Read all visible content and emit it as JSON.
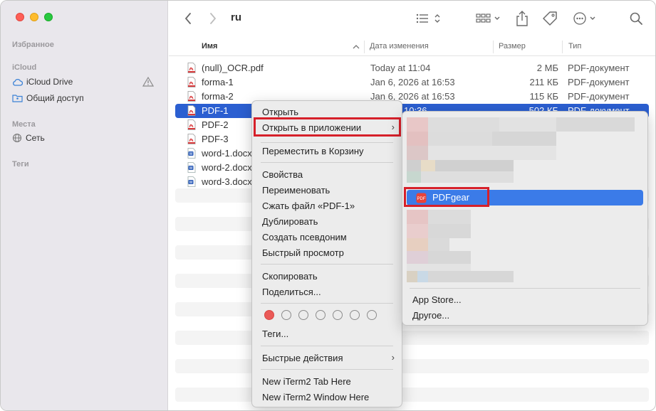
{
  "sidebar": {
    "favorites_heading": "Избранное",
    "icloud_heading": "iCloud",
    "icloud_items": [
      {
        "label": "iCloud Drive",
        "icon": "cloud-icon"
      },
      {
        "label": "Общий доступ",
        "icon": "shared-folder-icon"
      }
    ],
    "locations_heading": "Места",
    "locations_items": [
      {
        "label": "Сеть",
        "icon": "network-globe-icon"
      }
    ],
    "tags_heading": "Теги"
  },
  "toolbar": {
    "folder_title": "ru",
    "icons": [
      "back-chevron-icon",
      "forward-chevron-icon",
      "list-view-icon",
      "grid-view-icon",
      "share-icon",
      "tag-icon",
      "more-actions-icon",
      "search-icon"
    ]
  },
  "columns": {
    "name": "Имя",
    "date": "Дата изменения",
    "size": "Размер",
    "kind": "Тип"
  },
  "files": [
    {
      "name": "(null)_OCR.pdf",
      "date": "Today at 11:04",
      "size": "2 МБ",
      "kind": "PDF-документ",
      "type": "pdf"
    },
    {
      "name": "forma-1",
      "date": "Jan 6, 2026 at 16:53",
      "size": "211 КБ",
      "kind": "PDF-документ",
      "type": "pdf"
    },
    {
      "name": "forma-2",
      "date": "Jan 6, 2026 at 16:53",
      "size": "115 КБ",
      "kind": "PDF-документ",
      "type": "pdf"
    },
    {
      "name": "PDF-1",
      "date": "2026 at 10:36",
      "size": "502 КБ",
      "kind": "PDF-документ",
      "type": "pdf",
      "selected": true
    },
    {
      "name": "PDF-2",
      "date": "",
      "size": "",
      "kind": "",
      "type": "pdf"
    },
    {
      "name": "PDF-3",
      "date": "",
      "size": "",
      "kind": "",
      "type": "pdf"
    },
    {
      "name": "word-1.docx",
      "date": "",
      "size": "",
      "kind": "",
      "type": "word"
    },
    {
      "name": "word-2.docx",
      "date": "",
      "size": "",
      "kind": "",
      "type": "word"
    },
    {
      "name": "word-3.docx",
      "date": "",
      "size": "",
      "kind": "",
      "type": "word"
    }
  ],
  "context_menu": {
    "open": "Открыть",
    "open_with": "Открыть в приложении",
    "move_to_trash": "Переместить в Корзину",
    "get_info": "Свойства",
    "rename": "Переименовать",
    "compress": "Сжать файл «PDF-1»",
    "duplicate": "Дублировать",
    "make_alias": "Создать псевдоним",
    "quick_look": "Быстрый просмотр",
    "copy": "Скопировать",
    "share": "Поделиться...",
    "tags": "Теги...",
    "quick_actions": "Быстрые действия",
    "iterm_tab": "New iTerm2 Tab Here",
    "iterm_window": "New iTerm2 Window Here",
    "tag_colors": [
      "#ea5a57",
      "none",
      "none",
      "none",
      "none",
      "none",
      "none"
    ]
  },
  "submenu": {
    "highlighted_app": "PDFgear",
    "app_store": "App Store...",
    "other": "Другое..."
  },
  "colors": {
    "selection": "#2b5fd1",
    "submenu_highlight": "#3b7be8",
    "annotation_box": "#d6202a"
  }
}
